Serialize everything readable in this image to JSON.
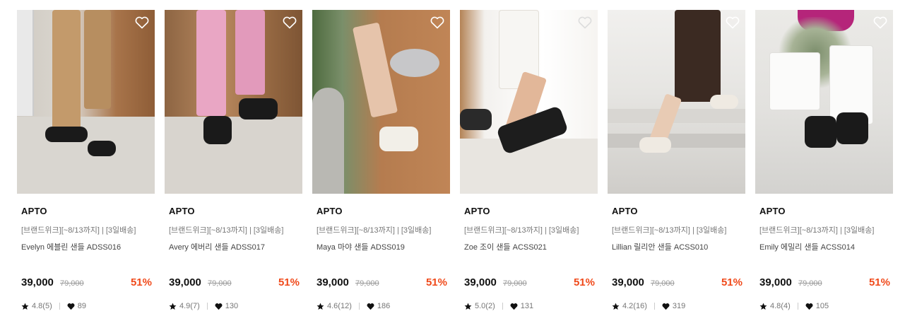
{
  "colors": {
    "discount": "#f04a1b",
    "text": "#111111",
    "muted": "#777777"
  },
  "icons": {
    "wishlist": "heart-outline-icon",
    "rating": "star-icon",
    "likes": "heart-filled-icon"
  },
  "products": [
    {
      "brand": "APTO",
      "tag": "[브랜드위크][~8/13까지] | [3일배송]",
      "name": "Evelyn 에블린 샌들 ADSS016",
      "price": "39,000",
      "original_price": "79,000",
      "discount": "51%",
      "rating": "4.8(5)",
      "likes": "89"
    },
    {
      "brand": "APTO",
      "tag": "[브랜드위크][~8/13까지] | [3일배송]",
      "name": "Avery 에버리 샌들 ADSS017",
      "price": "39,000",
      "original_price": "79,000",
      "discount": "51%",
      "rating": "4.9(7)",
      "likes": "130"
    },
    {
      "brand": "APTO",
      "tag": "[브랜드위크][~8/13까지] | [3일배송]",
      "name": "Maya 마야 샌들 ADSS019",
      "price": "39,000",
      "original_price": "79,000",
      "discount": "51%",
      "rating": "4.6(12)",
      "likes": "186"
    },
    {
      "brand": "APTO",
      "tag": "[브랜드위크][~8/13까지] | [3일배송]",
      "name": "Zoe 조이 샌들 ACSS021",
      "price": "39,000",
      "original_price": "79,000",
      "discount": "51%",
      "rating": "5.0(2)",
      "likes": "131"
    },
    {
      "brand": "APTO",
      "tag": "[브랜드위크][~8/13까지] | [3일배송]",
      "name": "Lillian 릴리안 샌들 ACSS010",
      "price": "39,000",
      "original_price": "79,000",
      "discount": "51%",
      "rating": "4.2(16)",
      "likes": "319"
    },
    {
      "brand": "APTO",
      "tag": "[브랜드위크][~8/13까지] | [3일배송]",
      "name": "Emily 에밀리 샌들 ACSS014",
      "price": "39,000",
      "original_price": "79,000",
      "discount": "51%",
      "rating": "4.8(4)",
      "likes": "105"
    }
  ]
}
